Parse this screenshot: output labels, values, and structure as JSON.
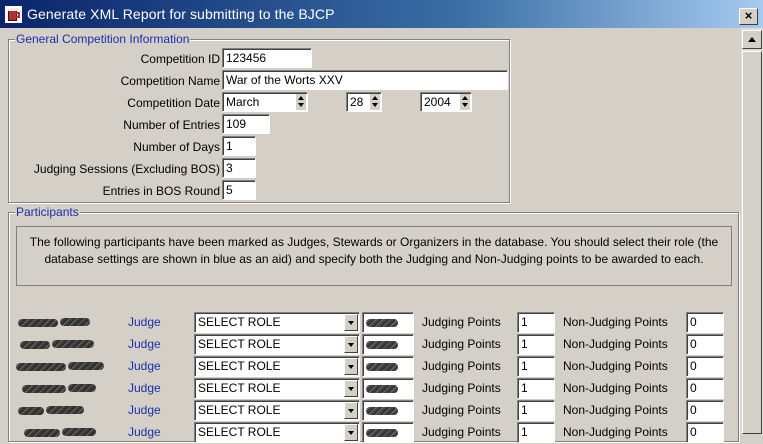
{
  "window": {
    "title": "Generate XML Report for submitting to the BJCP",
    "close_label": "×"
  },
  "general": {
    "legend": "General Competition Information",
    "competition_id_label": "Competition ID",
    "competition_id": "123456",
    "competition_name_label": "Competition Name",
    "competition_name": "War of the Worts XXV",
    "competition_date_label": "Competition Date",
    "date_month": "March",
    "date_day": "28",
    "date_year": "2004",
    "entries_label": "Number of Entries",
    "entries": "109",
    "days_label": "Number of Days",
    "days": "1",
    "sessions_label": "Judging Sessions (Excluding BOS)",
    "sessions": "3",
    "bos_label": "Entries in BOS Round",
    "bos": "5"
  },
  "participants": {
    "legend": "Participants",
    "info": "The following participants have been marked as Judges, Stewards or Organizers in the database.  You should select their role (the database settings are shown in blue as an aid) and specify both the Judging and Non-Judging points to be awarded to each.",
    "judging_points_label": "Judging Points",
    "non_judging_points_label": "Non-Judging Points",
    "rows": [
      {
        "db_role": "Judge",
        "role": "SELECT ROLE",
        "judging_points": "1",
        "non_judging_points": "0"
      },
      {
        "db_role": "Judge",
        "role": "SELECT ROLE",
        "judging_points": "1",
        "non_judging_points": "0"
      },
      {
        "db_role": "Judge",
        "role": "SELECT ROLE",
        "judging_points": "1",
        "non_judging_points": "0"
      },
      {
        "db_role": "Judge",
        "role": "SELECT ROLE",
        "judging_points": "1",
        "non_judging_points": "0"
      },
      {
        "db_role": "Judge",
        "role": "SELECT ROLE",
        "judging_points": "1",
        "non_judging_points": "0"
      },
      {
        "db_role": "Judge",
        "role": "SELECT ROLE",
        "judging_points": "1",
        "non_judging_points": "0"
      }
    ]
  }
}
